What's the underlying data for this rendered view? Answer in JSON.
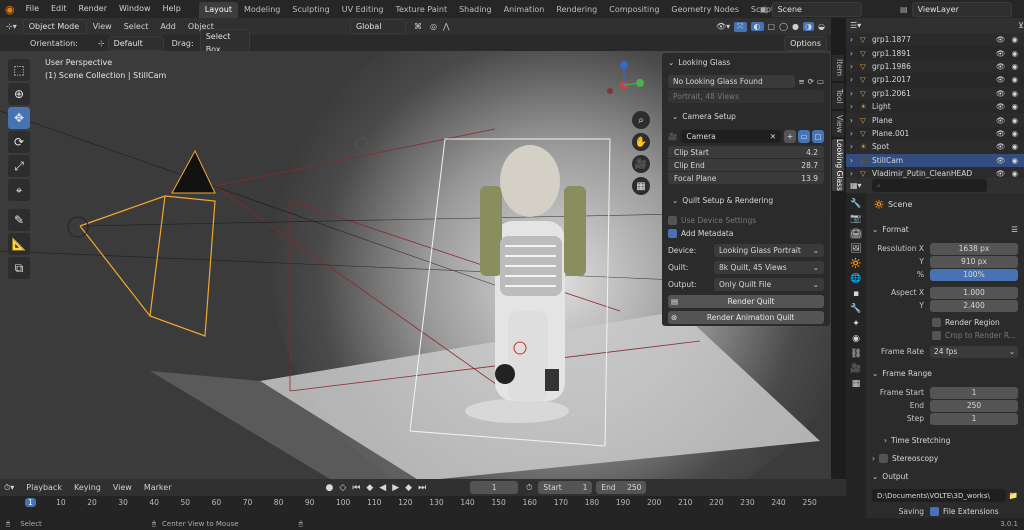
{
  "app": {
    "menu": [
      "File",
      "Edit",
      "Render",
      "Window",
      "Help"
    ],
    "workspaces": [
      "Layout",
      "Modeling",
      "Sculpting",
      "UV Editing",
      "Texture Paint",
      "Shading",
      "Animation",
      "Rendering",
      "Compositing",
      "Geometry Nodes",
      "Scripting"
    ],
    "active_workspace": "Layout",
    "scene": "Scene",
    "view_layer": "ViewLayer",
    "version": "3.0.1"
  },
  "viewport_header": {
    "mode": "Object Mode",
    "menus": [
      "View",
      "Select",
      "Add",
      "Object"
    ],
    "transform_orientation": "Global",
    "orientation_label": "Orientation:",
    "orientation_value": "Default",
    "drag_label": "Drag:",
    "drag_value": "Select Box",
    "options": "Options"
  },
  "viewport": {
    "perspective": "User Perspective",
    "collection": "(1) Scene Collection | StillCam"
  },
  "looking_glass": {
    "title": "Looking Glass",
    "device": "No Looking Glass Found",
    "device_info": "Portrait, 48 Views",
    "camera_setup_title": "Camera Setup",
    "camera_value": "Camera",
    "clip_start_label": "Clip Start",
    "clip_start": "4.2",
    "clip_end_label": "Clip End",
    "clip_end": "28.7",
    "focal_plane_label": "Focal Plane",
    "focal_plane": "13.9",
    "quilt_title": "Quilt Setup & Rendering",
    "use_device_settings": "Use Device Settings",
    "add_metadata": "Add Metadata",
    "device_label": "Device:",
    "device_value": "Looking Glass Portrait",
    "quilt_label": "Quilt:",
    "quilt_value": "8k Quilt, 45 Views",
    "output_label": "Output:",
    "output_value": "Only Quilt File",
    "render_quilt": "Render Quilt",
    "render_anim_quilt": "Render Animation Quilt",
    "sidetabs": [
      "Item",
      "Tool",
      "View",
      "Looking Glass"
    ]
  },
  "outliner": {
    "items": [
      {
        "name": "grp1.1877",
        "icon": "mesh-icon"
      },
      {
        "name": "grp1.1891",
        "icon": "mesh-icon"
      },
      {
        "name": "grp1.1986",
        "icon": "mesh-icon"
      },
      {
        "name": "grp1.2017",
        "icon": "mesh-icon"
      },
      {
        "name": "grp1.2061",
        "icon": "mesh-icon"
      },
      {
        "name": "Light",
        "icon": "light-icon"
      },
      {
        "name": "Plane",
        "icon": "mesh-icon"
      },
      {
        "name": "Plane.001",
        "icon": "mesh-icon"
      },
      {
        "name": "Spot",
        "icon": "light-icon"
      },
      {
        "name": "StillCam",
        "icon": "camera-icon"
      },
      {
        "name": "Vladimir_Putin_CleanHEAD",
        "icon": "mesh-icon"
      }
    ],
    "selected": "StillCam"
  },
  "properties": {
    "scene_label": "Scene",
    "format_title": "Format",
    "resolution_x_label": "Resolution X",
    "resolution_x": "1638 px",
    "resolution_y_label": "Y",
    "resolution_y": "910 px",
    "percent_label": "%",
    "percent": "100%",
    "aspect_x_label": "Aspect X",
    "aspect_x": "1.000",
    "aspect_y_label": "Y",
    "aspect_y": "2.400",
    "render_region": "Render Region",
    "crop_region": "Crop to Render R...",
    "frame_rate_label": "Frame Rate",
    "frame_rate": "24 fps",
    "frame_range_title": "Frame Range",
    "frame_start_label": "Frame Start",
    "frame_start": "1",
    "end_label": "End",
    "end": "250",
    "step_label": "Step",
    "step": "1",
    "time_stretching": "Time Stretching",
    "stereoscopy": "Stereoscopy",
    "output_title": "Output",
    "output_path": "D:\\Documents\\VOLTE\\3D_works\\",
    "saving_label": "Saving",
    "file_extensions": "File Extensions"
  },
  "timeline": {
    "menus": [
      "Playback",
      "Keying",
      "View",
      "Marker"
    ],
    "current_frame": "1",
    "start_label": "Start",
    "start": "1",
    "end_label": "End",
    "end": "250",
    "ticks": [
      "1",
      "10",
      "20",
      "30",
      "40",
      "50",
      "60",
      "70",
      "80",
      "90",
      "100",
      "110",
      "120",
      "130",
      "140",
      "150",
      "160",
      "170",
      "180",
      "190",
      "200",
      "210",
      "220",
      "230",
      "240",
      "250"
    ]
  },
  "statusbar": {
    "select": "Select",
    "center": "Center View to Mouse"
  }
}
